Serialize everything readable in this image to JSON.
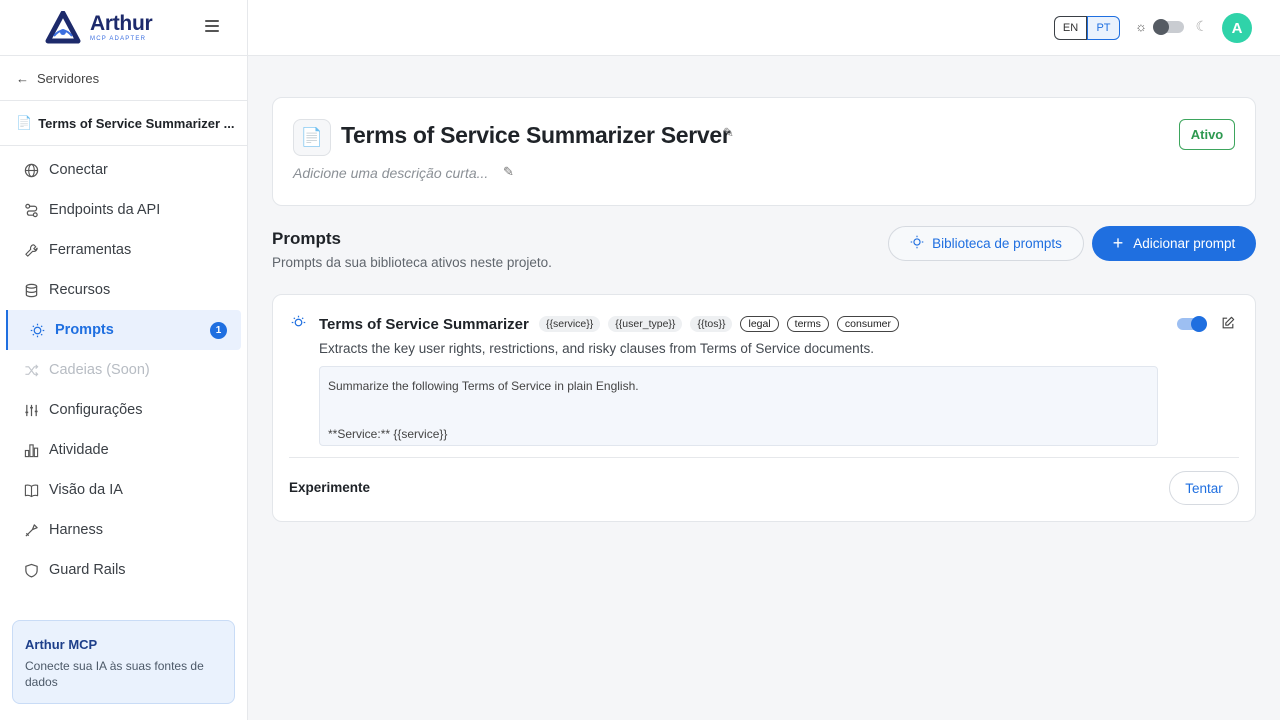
{
  "brand": {
    "name": "Arthur",
    "subtitle": "MCP ADAPTER"
  },
  "sidebar": {
    "back_label": "Servidores",
    "server_name": "Terms of Service Summarizer ...",
    "items": [
      {
        "label": "Conectar",
        "icon": "globe-icon"
      },
      {
        "label": "Endpoints da API",
        "icon": "route-icon"
      },
      {
        "label": "Ferramentas",
        "icon": "wrench-icon"
      },
      {
        "label": "Recursos",
        "icon": "database-icon"
      },
      {
        "label": "Prompts",
        "icon": "lightbulb-icon",
        "badge": "1",
        "active": true
      },
      {
        "label": "Cadeias (Soon)",
        "icon": "shuffle-icon",
        "disabled": true
      },
      {
        "label": "Configurações",
        "icon": "sliders-icon"
      },
      {
        "label": "Atividade",
        "icon": "bar-chart-icon"
      },
      {
        "label": "Visão da IA",
        "icon": "book-icon"
      },
      {
        "label": "Harness",
        "icon": "tool-icon"
      },
      {
        "label": "Guard Rails",
        "icon": "shield-icon"
      }
    ],
    "promo": {
      "title": "Arthur MCP",
      "description": "Conecte sua IA às suas fontes de dados"
    }
  },
  "topbar": {
    "lang_en": "EN",
    "lang_pt": "PT",
    "active_lang": "PT",
    "avatar_initial": "A"
  },
  "server": {
    "title": "Terms of Service Summarizer Server",
    "description_placeholder": "Adicione uma descrição curta...",
    "status": "Ativo"
  },
  "prompts_section": {
    "title": "Prompts",
    "subtitle": "Prompts da sua biblioteca ativos neste projeto.",
    "library_button": "Biblioteca de prompts",
    "add_button": "Adicionar prompt"
  },
  "prompt": {
    "name": "Terms of Service Summarizer",
    "variables": [
      "{{service}}",
      "{{user_type}}",
      "{{tos}}"
    ],
    "labels": [
      "legal",
      "terms",
      "consumer"
    ],
    "description": "Extracts the key user rights, restrictions, and risky clauses from Terms of Service documents.",
    "body_line1": "Summarize the following Terms of Service in plain English.",
    "body_line2": "**Service:** {{service}}",
    "enabled": true,
    "experiment_label": "Experimente",
    "try_button": "Tentar"
  },
  "colors": {
    "accent": "#1f6fe0",
    "status_green": "#2e9950",
    "avatar": "#2fd3a9"
  }
}
